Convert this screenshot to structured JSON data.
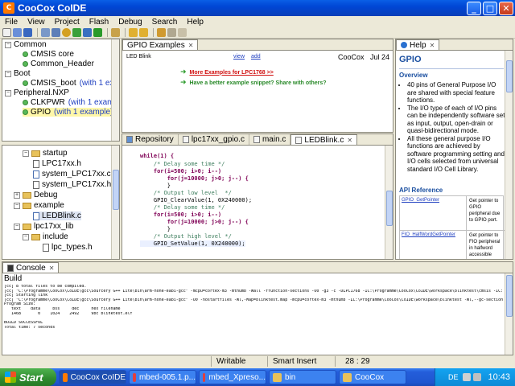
{
  "window": {
    "title": "CooCox CoIDE",
    "minimize": "_",
    "maximize": "□",
    "close": "✕"
  },
  "menu": [
    "File",
    "View",
    "Project",
    "Flash",
    "Debug",
    "Search",
    "Help"
  ],
  "components": {
    "items": [
      {
        "label": "Common",
        "suffix": ""
      },
      {
        "label": "CMSIS core",
        "suffix": ""
      },
      {
        "label": "Common_Header",
        "suffix": ""
      },
      {
        "label": "Boot",
        "suffix": ""
      },
      {
        "label": "CMSIS_boot",
        "suffix": "(with 1 example)"
      },
      {
        "label": "Peripheral.NXP",
        "suffix": ""
      },
      {
        "label": "CLKPWR",
        "suffix": "(with 1 example)"
      },
      {
        "label": "GPIO",
        "suffix": "(with 1 example)"
      }
    ]
  },
  "examples": {
    "tab_label": "GPIO Examples",
    "example_name": "LED Blink",
    "view_link": "view",
    "add_link": "add",
    "author": "CooCox",
    "date": "Jul 24",
    "more_link": "More Examples for LPC1768 >>",
    "share_link": "Have a better example snippet? Share with others?"
  },
  "project_tree": {
    "items": [
      {
        "label": "startup",
        "type": "folder"
      },
      {
        "label": "LPC17xx.h",
        "type": "h"
      },
      {
        "label": "system_LPC17xx.c",
        "type": "c"
      },
      {
        "label": "system_LPC17xx.h",
        "type": "h"
      },
      {
        "label": "Debug",
        "type": "folder"
      },
      {
        "label": "example",
        "type": "folder"
      },
      {
        "label": "LEDBlink.c",
        "type": "c"
      },
      {
        "label": "lpc17xx_lib",
        "type": "folder"
      },
      {
        "label": "include",
        "type": "folder"
      },
      {
        "label": "lpc_types.h",
        "type": "h"
      }
    ]
  },
  "editor": {
    "tabs": [
      "Repository",
      "lpc17xx_gpio.c",
      "main.c",
      "LEDBlink.c"
    ],
    "lines": [
      "while(1) {",
      "    /* Delay some time */",
      "    for(i=500; i>0; i--)",
      "        for(j=10000; j>0; j--) {",
      "        }",
      "    /* Output low level  */",
      "    GPIO_ClearValue(1, 0X240000);",
      "    /* Delay some time */",
      "    for(i=500; i>0; i--)",
      "        for(j=10000; j>0; j--) {",
      "        }",
      "    /* Output high level */",
      "    GPIO_SetValue(1, 0X240000);"
    ]
  },
  "help": {
    "tab_label": "Help",
    "title": "GPIO",
    "overview_label": "Overview",
    "bullets": [
      "40 pins of General Purpose I/O are shared with special feature functions.",
      "The I/O type of each of I/O pins can be independently software set as input, output, open-drain or quasi-bidirectional mode.",
      "All these general purpose I/O functions are achieved by software programming setting and I/O cells selected from universal standard I/O Cell Library."
    ],
    "api_label": "API Reference",
    "api_rows": [
      {
        "name": "GPIO_GetPointer",
        "desc": "Get pointer to GPIO peripheral due to GPIO port."
      },
      {
        "name": "FIO_HalfWordGetPointer",
        "desc": "Get pointer to FIO peripheral in halfword accessible"
      }
    ]
  },
  "console": {
    "tab_label": "Console",
    "build_label": "Build",
    "lines": [
      "[cc] 8 total files to be compiled.",
      "[cc] \"C:\\Programme\\CooCox\\CoIDE\\gcc\\Sourcery G++ Lite\\bin\\arm-none-eabi-gcc\" -mcpu=cortex-m3 -mthumb -Wall -ffunction-sections -O0 -g3 -c -DLPC1768 -IC:\\Programme\\CooCox\\CoIDE\\workspace\\blinktest\\cmsis -IC:\\Programme",
      "[cc] Starting link",
      "[cc] \"C:\\Programme\\CooCox\\CoIDE\\gcc\\Sourcery G++ Lite\\bin\\arm-none-eabi-gcc\" -O0 -nostartfiles -Wl,-Map=blinktest.map -mcpu=cortex-m3 -mthumb -LC:\\Programme\\CooCox\\CoIDE\\workspace\\blinktest -Wl,--gc-sections -Wl",
      "Program Size:",
      "   text    data     bss     dec     hex filename",
      "   1468       0    1024    2492     9bc blinktest.elf",
      "",
      "BUILD SUCCESSFUL",
      "Total time: 7 seconds"
    ]
  },
  "status": {
    "mode": "Writable",
    "insert": "Smart Insert",
    "position": "28 : 29"
  },
  "taskbar": {
    "start": "Start",
    "tasks": [
      "CooCox CoIDE",
      "mbed-005.1.p...",
      "mbed_Xpreso...",
      "bin",
      "CooCox"
    ],
    "lang": "DE",
    "time": "10:43"
  }
}
